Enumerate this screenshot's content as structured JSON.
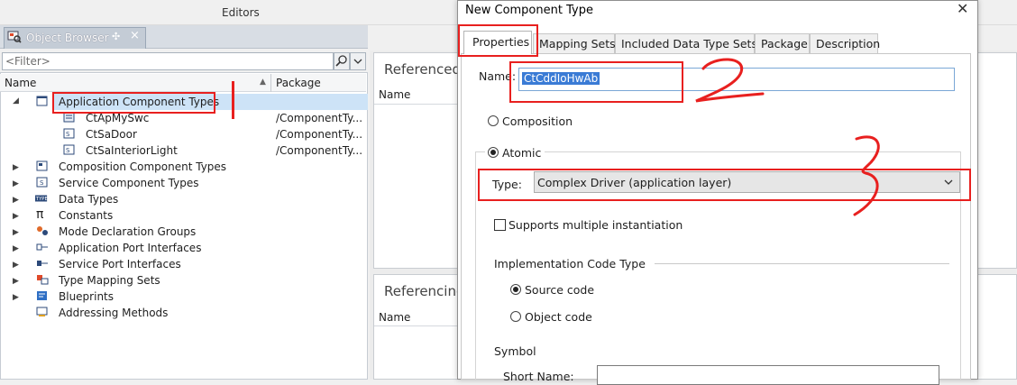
{
  "editors": {
    "title": "Editors"
  },
  "object_browser": {
    "tab_label": "Object Browser",
    "pin_glyph": "✣",
    "close_glyph": "×",
    "filter_placeholder": "<Filter>",
    "columns": {
      "name": "Name",
      "package": "Package"
    },
    "tree": [
      {
        "label": "Application Component Types",
        "expanded": true,
        "selected": true,
        "icon": "component-types-icon"
      },
      {
        "label": "CtApMySwc",
        "package": "/ComponentTy...",
        "child": true,
        "icon": "swc-icon"
      },
      {
        "label": "CtSaDoor",
        "package": "/ComponentTy...",
        "child": true,
        "icon": "sensor-actuator-icon"
      },
      {
        "label": "CtSaInteriorLight",
        "package": "/ComponentTy...",
        "child": true,
        "icon": "sensor-actuator-icon"
      },
      {
        "label": "Composition Component Types",
        "icon": "composition-icon"
      },
      {
        "label": "Service Component Types",
        "icon": "service-icon"
      },
      {
        "label": "Data Types",
        "icon": "data-type-icon"
      },
      {
        "label": "Constants",
        "icon": "pi-icon"
      },
      {
        "label": "Mode Declaration Groups",
        "icon": "mode-icon"
      },
      {
        "label": "Application Port Interfaces",
        "icon": "port-interface-icon"
      },
      {
        "label": "Service Port Interfaces",
        "icon": "service-port-icon"
      },
      {
        "label": "Type Mapping Sets",
        "icon": "mapping-icon"
      },
      {
        "label": "Blueprints",
        "icon": "blueprint-icon"
      },
      {
        "label": "Addressing Methods",
        "icon": "addressing-icon"
      }
    ]
  },
  "background_panels": {
    "referenced_title": "Referenced C",
    "referencing_title": "Referencing",
    "name_col": "Name"
  },
  "dialog": {
    "title": "New Component Type",
    "close_glyph": "✕",
    "tabs": [
      "Properties",
      "Mapping Sets",
      "Included Data Type Sets",
      "Package",
      "Description"
    ],
    "active_tab": "Properties",
    "name_label": "Name:",
    "name_value": "CtCddIoHwAb",
    "composition_label": "Composition",
    "atomic_label": "Atomic",
    "selected_kind": "Atomic",
    "type_label": "Type:",
    "type_value": "Complex Driver (application layer)",
    "multi_instance_label": "Supports multiple instantiation",
    "multi_instance_checked": false,
    "impl_code_label": "Implementation Code Type",
    "source_code_label": "Source code",
    "object_code_label": "Object code",
    "selected_code": "Source code",
    "symbol_label": "Symbol",
    "short_name_label": "Short Name:"
  },
  "colors": {
    "annotation_red": "#e8201f",
    "selection_bg": "#cde3f7",
    "name_highlight": "#3a7bd5"
  }
}
